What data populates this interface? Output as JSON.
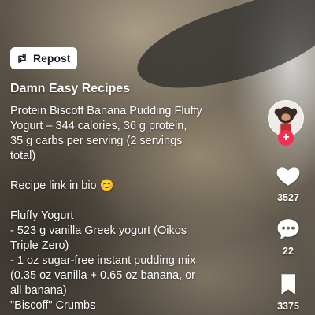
{
  "repost": {
    "label": "Repost",
    "icon": "repost-icon"
  },
  "post": {
    "author": "Damn Easy Recipes",
    "caption_lines": [
      "Protein Biscoff Banana Pudding Fluffy",
      "Yogurt – 344 calories, 36 g protein,",
      "35 g carbs per serving (2 servings",
      "total)",
      "",
      "Recipe link in bio 😊",
      "",
      "Fluffy Yogurt",
      "- 523 g vanilla Greek yogurt (Oikos",
      "Triple Zero)",
      "- 1 oz sugar-free instant pudding mix",
      "(0.35 oz vanilla + 0.65 oz banana, or",
      "all banana)",
      "\"Biscoff\" Crumbs"
    ]
  },
  "actions": {
    "likes": "3527",
    "comments": "22",
    "saves": "3375"
  },
  "colors": {
    "accent": "#fe2c55",
    "text": "#ffffff"
  }
}
